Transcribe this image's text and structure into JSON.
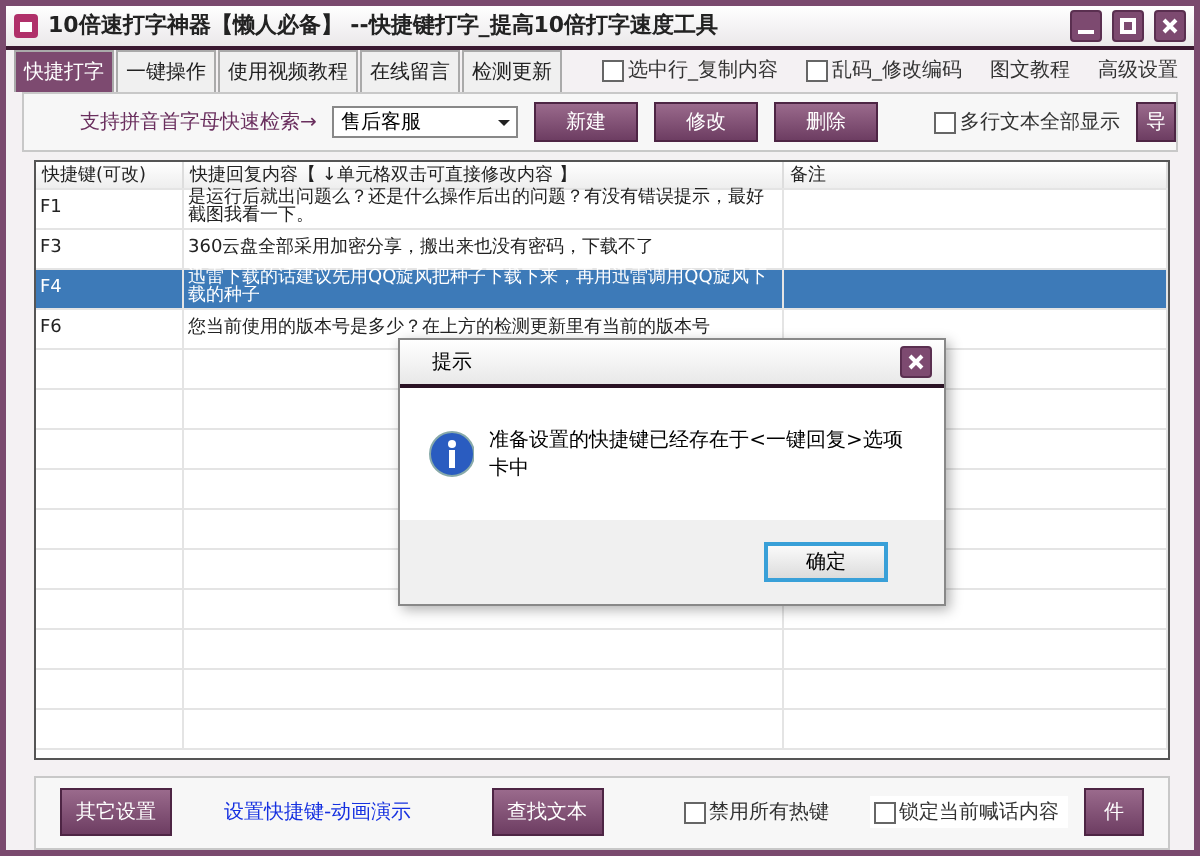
{
  "window": {
    "title": "10倍速打字神器【懒人必备】 --快捷键打字_提高10倍打字速度工具"
  },
  "tabs": [
    {
      "label": "快捷打字",
      "selected": true
    },
    {
      "label": "一键操作",
      "selected": false
    },
    {
      "label": "使用视频教程",
      "selected": false
    },
    {
      "label": "在线留言",
      "selected": false
    },
    {
      "label": "检测更新",
      "selected": false
    }
  ],
  "top_options": [
    {
      "kind": "checkbox",
      "label": "选中行_复制内容",
      "checked": false
    },
    {
      "kind": "checkbox",
      "label": "乱码_修改编码",
      "checked": false
    },
    {
      "kind": "link",
      "label": "图文教程"
    },
    {
      "kind": "link",
      "label": "高级设置"
    }
  ],
  "toolbar": {
    "search_label": "支持拼音首字母快速检索→",
    "search_value": "售后客服",
    "buttons": [
      "新建",
      "修改",
      "删除"
    ],
    "multiline_checkbox": {
      "label": "多行文本全部显示",
      "checked": false
    },
    "edge_button": "导"
  },
  "table": {
    "columns": [
      "快捷键(可改)",
      "快捷回复内容【 ↓单元格双击可直接修改内容 】",
      "备注"
    ],
    "rows": [
      {
        "key": "F1",
        "reply": "是运行后就出问题么？还是什么操作后出的问题？有没有错误提示，最好截图我看一下。",
        "note": "",
        "selected": false
      },
      {
        "key": "F3",
        "reply": "360云盘全部采用加密分享，搬出来也没有密码，下载不了",
        "note": "",
        "selected": false
      },
      {
        "key": "F4",
        "reply": "迅雷下载的话建议先用QQ旋风把种子下载下来，再用迅雷调用QQ旋风下载的种子",
        "note": "",
        "selected": true
      },
      {
        "key": "F6",
        "reply": "您当前使用的版本号是多少？在上方的检测更新里有当前的版本号",
        "note": "",
        "selected": false
      }
    ]
  },
  "bottom": {
    "settings_button": "其它设置",
    "demo_link": "设置快捷键-动画演示",
    "find_button": "查找文本",
    "hotkey_checkbox": {
      "label": "禁用所有热键",
      "checked": false
    },
    "lock_checkbox": {
      "label": "锁定当前喊话内容",
      "checked": false
    },
    "last_button": "件"
  },
  "dialog": {
    "title": "提示",
    "message": "准备设置的快捷键已经存在于<一键回复>选项卡中",
    "ok": "确定"
  }
}
